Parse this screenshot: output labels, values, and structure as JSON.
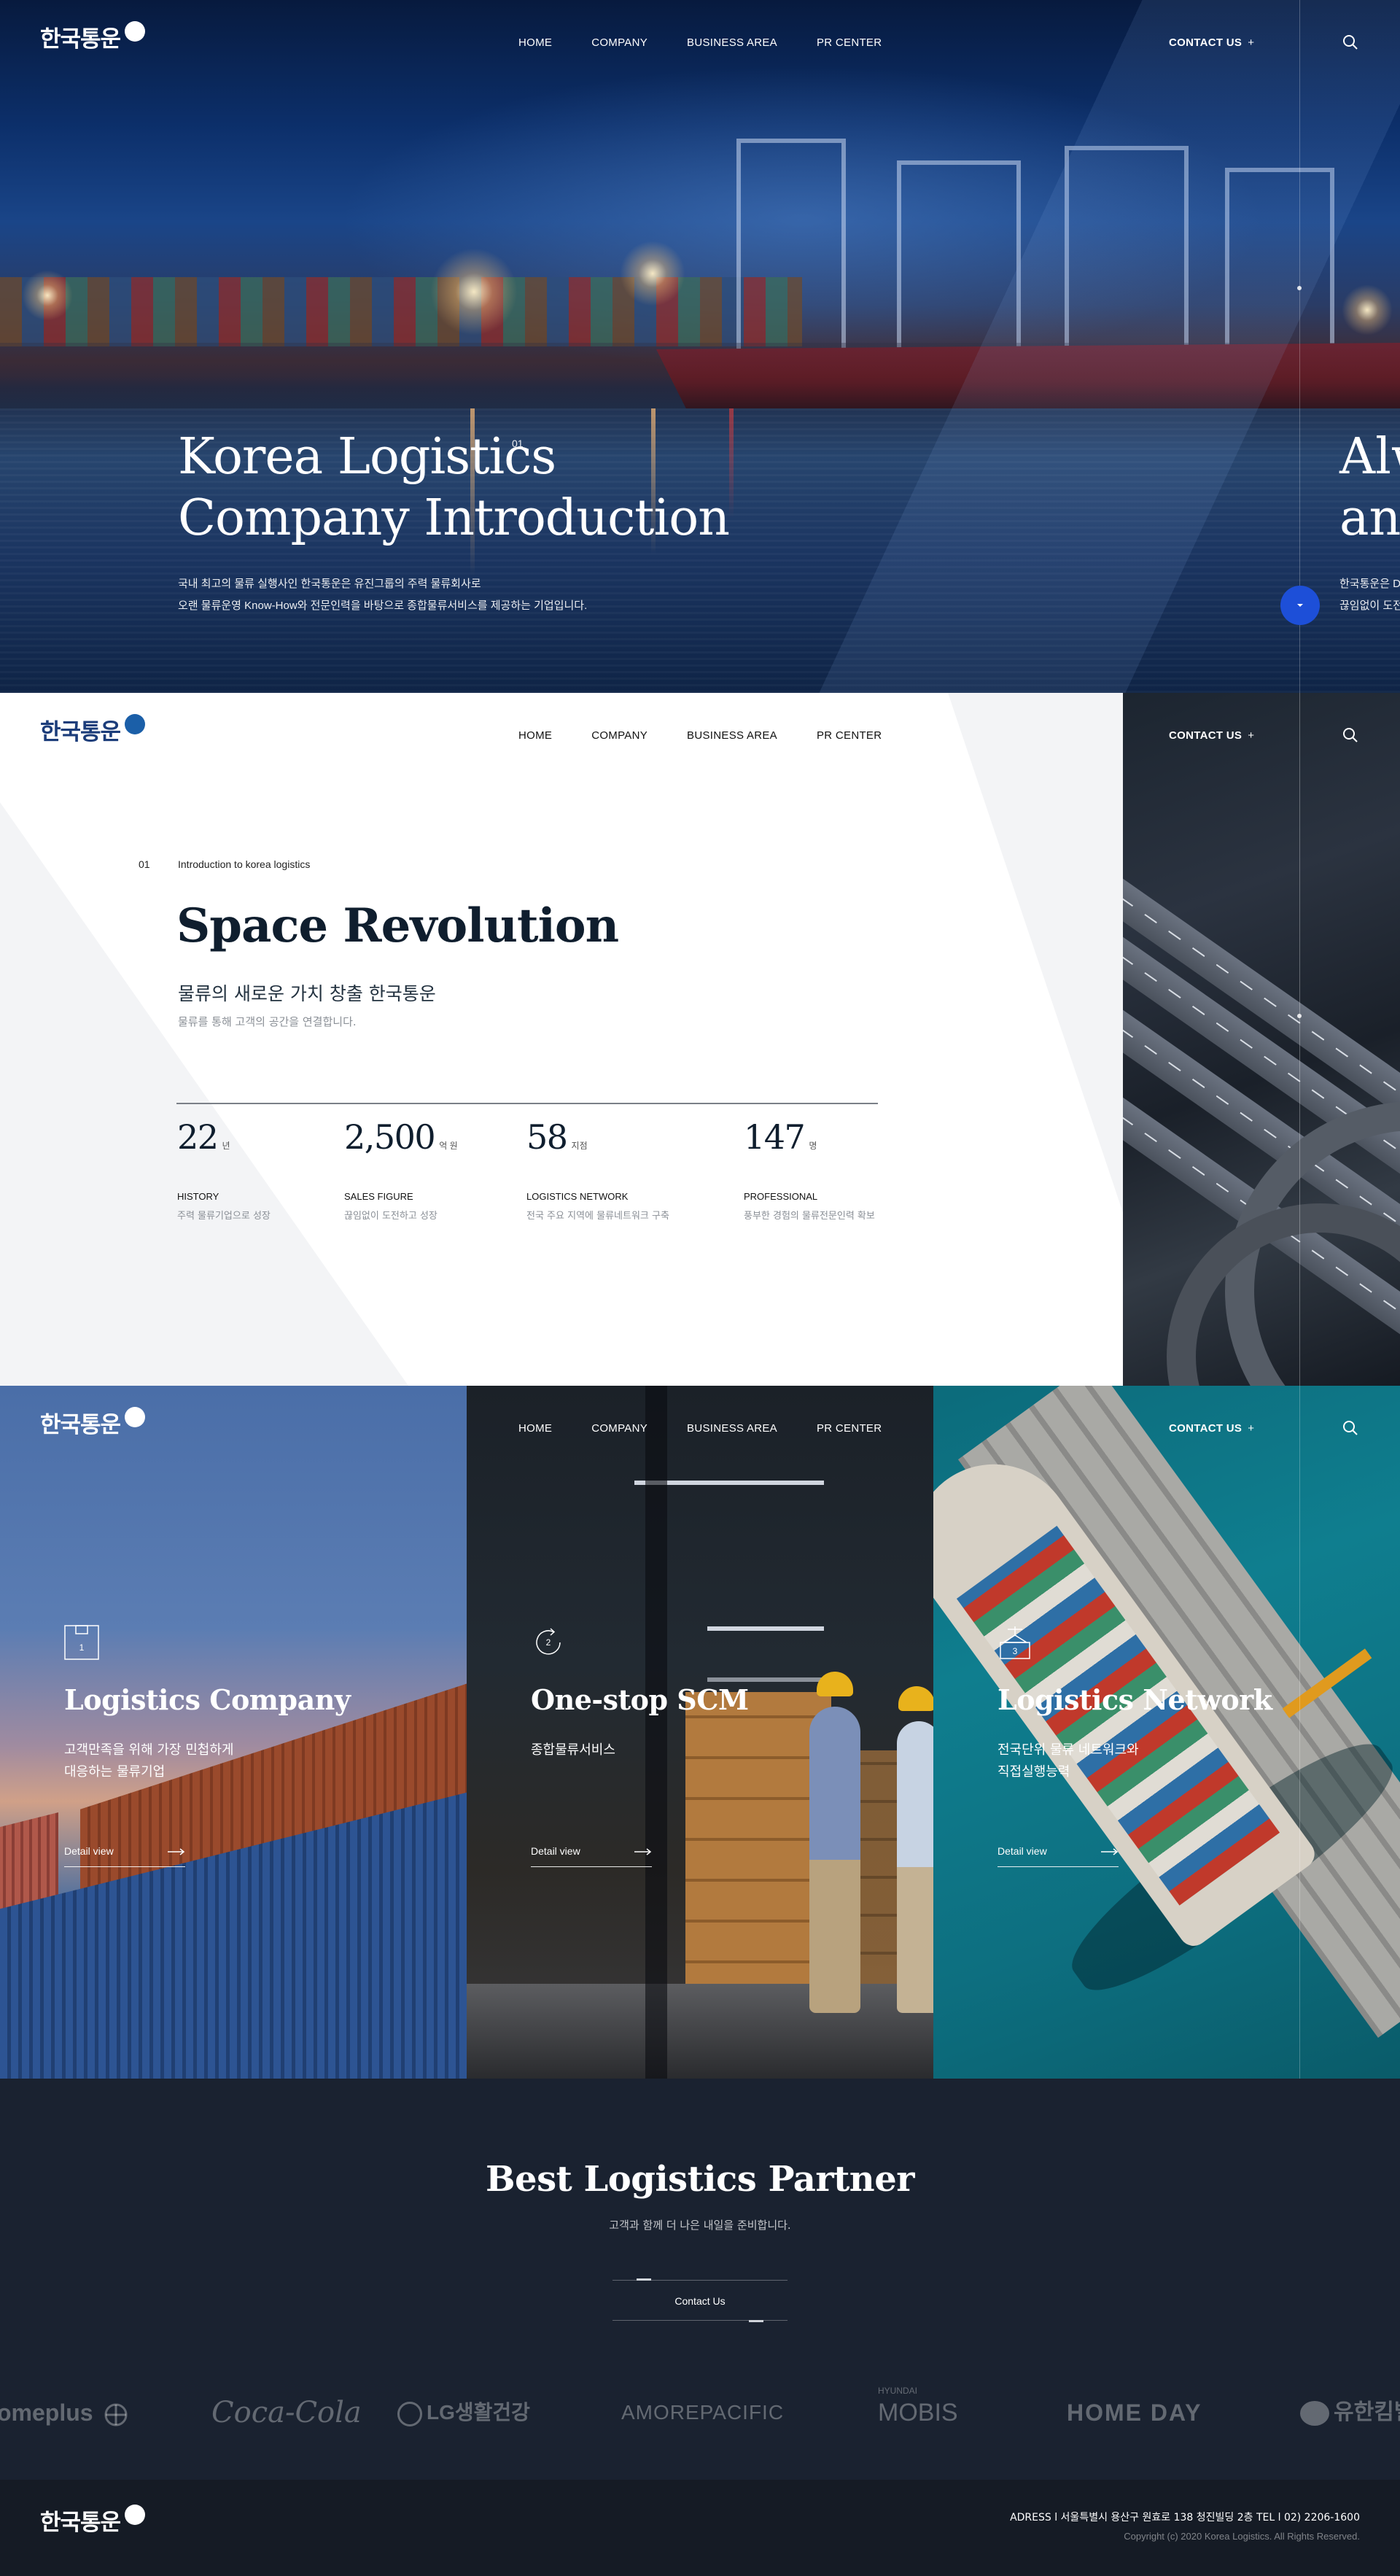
{
  "brand": {
    "logo_text": "한국통운",
    "accent": "#1d4fd8",
    "logo_mark_color": "#1b5fa8"
  },
  "nav": {
    "home": "HOME",
    "company": "COMPANY",
    "business": "BUSINESS AREA",
    "pr": "PR CENTER",
    "contact": "CONTACT US",
    "contact_plus": "+"
  },
  "hero": {
    "title_line1": "Korea Logistics",
    "title_line2": "Company Introduction",
    "slide_number": "01",
    "desc_line1": "국내 최고의 물류 실행사인 한국통운은 유진그룹의 주력 물류회사로",
    "desc_line2": "오랜 물류운영 Know-How와 전문인력을 바탕으로 종합물류서비스를 제공하는 기업입니다.",
    "next_title_line1": "Alw",
    "next_title_line2": "and",
    "next_desc_line1": "한국통운은 D",
    "next_desc_line2": "끊임없이 도전"
  },
  "intro": {
    "index": "01",
    "subtitle": "Introduction to korea logistics",
    "title": "Space Revolution",
    "ko_title": "물류의 새로운 가치 창출 한국통운",
    "ko_sub": "물류를 통해 고객의 공간을 연결합니다.",
    "stats": [
      {
        "num": "22",
        "unit": "년",
        "label": "HISTORY",
        "desc": "주력 물류기업으로 성장"
      },
      {
        "num": "2,500",
        "unit": "억 원",
        "label": "SALES FIGURE",
        "desc": "끊임없이 도전하고 성장"
      },
      {
        "num": "58",
        "unit": "지점",
        "label": "LOGISTICS NETWORK",
        "desc": "전국 주요 지역에 물류네트워크 구축"
      },
      {
        "num": "147",
        "unit": "명",
        "label": "PROFESSIONAL",
        "desc": "풍부한 경험의 물류전문인력 확보"
      }
    ]
  },
  "panels": [
    {
      "icon_num": "1",
      "title": "Logistics Company",
      "desc_line1": "고객만족을 위해 가장 민첩하게",
      "desc_line2": "대응하는 물류기업",
      "link": "Detail view"
    },
    {
      "icon_num": "2",
      "title": "One-stop SCM",
      "desc_line1": "종합물류서비스",
      "desc_line2": "",
      "link": "Detail view"
    },
    {
      "icon_num": "3",
      "title": "Logistics Network",
      "desc_line1": "전국단위 물류 네트워크와",
      "desc_line2": "직접실행능력",
      "link": "Detail view"
    }
  ],
  "partner": {
    "title": "Best Logistics Partner",
    "subtitle": "고객과 함께 더 나은 내일을 준비합니다.",
    "button": "Contact Us",
    "brands": [
      "omeplus",
      "Coca-Cola",
      "LG생활건강",
      "AMOREPACIFIC",
      "HYUNDAI",
      "MOBIS",
      "HOME DAY",
      "유한킴벌리"
    ]
  },
  "footer": {
    "address": "ADRESS  l  서울특별시 용산구 원효로 138 청진빌딩 2층      TEL  l  02) 2206-1600",
    "copyright": "Copyright (c) 2020 Korea Logistics. All Rights Reserved."
  }
}
